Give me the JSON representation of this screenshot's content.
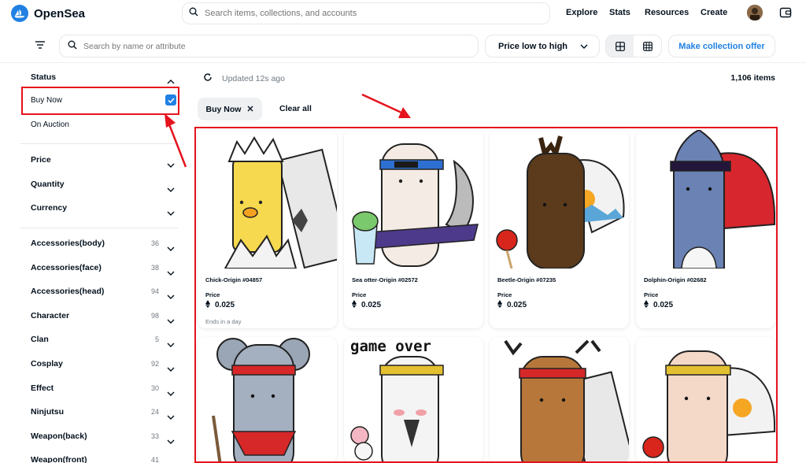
{
  "header": {
    "brand": "OpenSea",
    "search_placeholder": "Search items, collections, and accounts",
    "nav": [
      "Explore",
      "Stats",
      "Resources",
      "Create"
    ]
  },
  "toolbar": {
    "attr_search_placeholder": "Search by name or attribute",
    "sort_label": "Price low to high",
    "offer_button": "Make collection offer"
  },
  "sidebar": {
    "status_title": "Status",
    "status_options": [
      {
        "label": "Buy Now",
        "checked": true
      },
      {
        "label": "On Auction",
        "checked": false
      }
    ],
    "sections": [
      "Price",
      "Quantity",
      "Currency"
    ],
    "traits": [
      {
        "label": "Accessories(body)",
        "count": "36"
      },
      {
        "label": "Accessories(face)",
        "count": "38"
      },
      {
        "label": "Accessories(head)",
        "count": "94"
      },
      {
        "label": "Character",
        "count": "98"
      },
      {
        "label": "Clan",
        "count": "5"
      },
      {
        "label": "Cosplay",
        "count": "92"
      },
      {
        "label": "Effect",
        "count": "30"
      },
      {
        "label": "Ninjutsu",
        "count": "24"
      },
      {
        "label": "Weapon(back)",
        "count": "33"
      },
      {
        "label": "Weapon(front)",
        "count": "41"
      }
    ]
  },
  "main": {
    "updated": "Updated 12s ago",
    "items_count": "1,106 items",
    "chip_label": "Buy Now",
    "clear_all": "Clear all",
    "price_label": "Price",
    "cards": [
      {
        "name": "Chick-Origin #04857",
        "price": "0.025",
        "ends": "Ends in a day"
      },
      {
        "name": "Sea otter-Origin #02572",
        "price": "0.025",
        "ends": ""
      },
      {
        "name": "Beetle-Origin #07235",
        "price": "0.025",
        "ends": ""
      },
      {
        "name": "Dolphin-Origin #02682",
        "price": "0.025",
        "ends": ""
      }
    ],
    "second_row_caption": "game over"
  },
  "colors": {
    "accent": "#2081e2",
    "highlight": "#e5131d",
    "text": "#04111d",
    "muted": "#707a83"
  }
}
